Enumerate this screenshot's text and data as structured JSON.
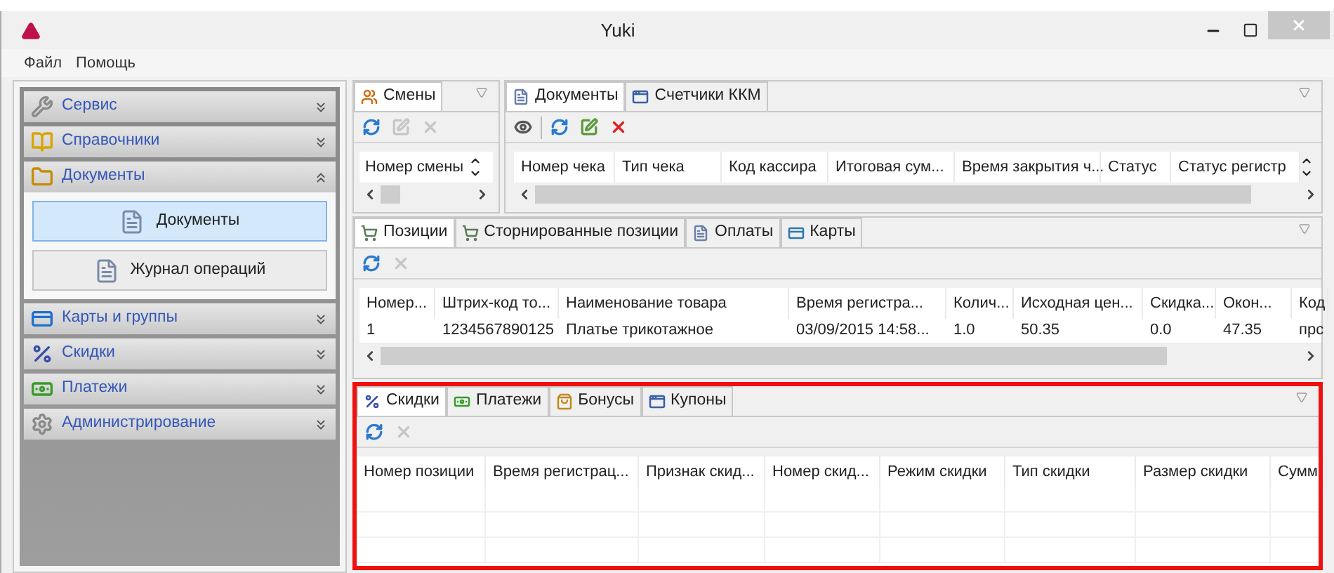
{
  "window": {
    "title": "Yuki"
  },
  "menu": [
    "Файл",
    "Помощь"
  ],
  "sidebar": {
    "groups": [
      {
        "label": "Сервис",
        "kind": "wrench",
        "expanded": false
      },
      {
        "label": "Справочники",
        "kind": "book",
        "expanded": false
      },
      {
        "label": "Документы",
        "kind": "folder",
        "expanded": true,
        "items": [
          {
            "label": "Документы",
            "selected": true
          },
          {
            "label": "Журнал операций",
            "selected": false
          }
        ]
      },
      {
        "label": "Карты и группы",
        "kind": "cards",
        "expanded": false
      },
      {
        "label": "Скидки",
        "kind": "percent",
        "expanded": false
      },
      {
        "label": "Платежи",
        "kind": "money",
        "expanded": false
      },
      {
        "label": "Администрирование",
        "kind": "gears",
        "expanded": false
      }
    ]
  },
  "shifts_pane": {
    "tabs": [
      {
        "label": "Смены",
        "kind": "people",
        "selected": true
      }
    ],
    "tools": [
      {
        "kind": "refresh",
        "disabled": false
      },
      {
        "kind": "edit",
        "disabled": true
      },
      {
        "kind": "delete",
        "disabled": true
      }
    ],
    "columns": [
      "Номер смены"
    ]
  },
  "documents_pane": {
    "tabs": [
      {
        "label": "Документы",
        "kind": "document",
        "selected": true
      },
      {
        "label": "Счетчики ККМ",
        "kind": "window",
        "selected": false
      }
    ],
    "tools": [
      {
        "kind": "view",
        "disabled": false
      },
      {
        "kind": "refresh",
        "disabled": false
      },
      {
        "kind": "edit",
        "disabled": false
      },
      {
        "kind": "delete",
        "disabled": false
      }
    ],
    "columns": [
      "Номер чека",
      "Тип чека",
      "Код кассира",
      "Итоговая сум...",
      "Время закрытия ч...",
      "Статус",
      "Статус регистр"
    ]
  },
  "positions_pane": {
    "tabs": [
      {
        "label": "Позиции",
        "kind": "cart",
        "selected": true
      },
      {
        "label": "Сторнированные позиции",
        "kind": "cart",
        "selected": false
      },
      {
        "label": "Оплаты",
        "kind": "document",
        "selected": false
      },
      {
        "label": "Карты",
        "kind": "card",
        "selected": false
      }
    ],
    "tools": [
      {
        "kind": "refresh",
        "disabled": false
      },
      {
        "kind": "delete",
        "disabled": true
      }
    ],
    "columns": [
      "Номер...",
      "Штрих-код то...",
      "Наименование товара",
      "Время регистра...",
      "Колич...",
      "Исходная цен...",
      "Скидка...",
      "Окон...",
      "Код"
    ],
    "rows": [
      [
        "1",
        "1234567890125",
        "Платье трикотажное",
        "03/09/2015 14:58...",
        "1.0",
        "50.35",
        "0.0",
        "47.35",
        "прс"
      ]
    ]
  },
  "details_pane": {
    "tabs": [
      {
        "label": "Скидки",
        "kind": "percent",
        "selected": true
      },
      {
        "label": "Платежи",
        "kind": "money",
        "selected": false
      },
      {
        "label": "Бонусы",
        "kind": "bag",
        "selected": false
      },
      {
        "label": "Купоны",
        "kind": "window",
        "selected": false
      }
    ],
    "tools": [
      {
        "kind": "refresh",
        "disabled": false
      },
      {
        "kind": "delete",
        "disabled": true
      }
    ],
    "columns": [
      "Номер позиции",
      "Время регистрац...",
      "Признак скид...",
      "Номер скид...",
      "Режим скидки",
      "Тип скидки",
      "Размер скидки",
      "Сумм"
    ]
  }
}
